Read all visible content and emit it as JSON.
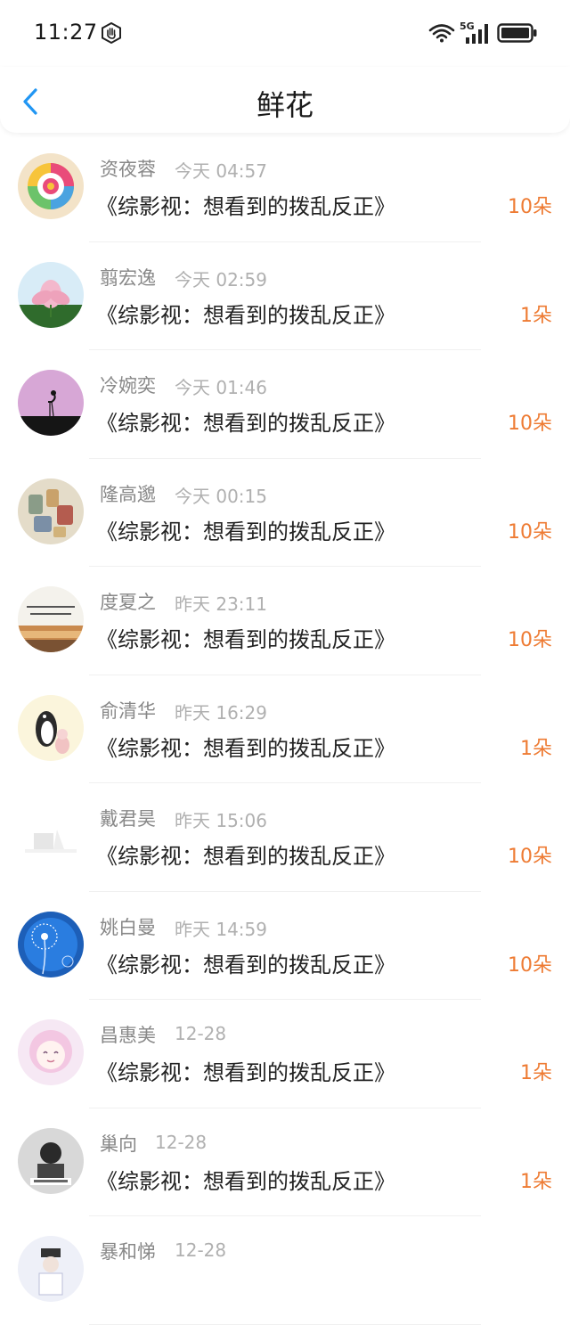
{
  "status_bar": {
    "time": "11:27",
    "network": "5G"
  },
  "header": {
    "title": "鲜花",
    "back_icon": "chevron-left-icon"
  },
  "colors": {
    "accent": "#2196f3",
    "count": "#ee7b33",
    "name": "#888888",
    "time": "#b0b0b0"
  },
  "items": [
    {
      "name": "资夜蓉",
      "time": "今天 04:57",
      "title": "《综影视：想看到的拨乱反正》",
      "count": "10朵",
      "avatar": "lollipop"
    },
    {
      "name": "翦宏逸",
      "time": "今天 02:59",
      "title": "《综影视：想看到的拨乱反正》",
      "count": "1朵",
      "avatar": "lotus"
    },
    {
      "name": "冷婉奕",
      "time": "今天 01:46",
      "title": "《综影视：想看到的拨乱反正》",
      "count": "10朵",
      "avatar": "flamingo"
    },
    {
      "name": "隆高邈",
      "time": "今天 00:15",
      "title": "《综影视：想看到的拨乱反正》",
      "count": "10朵",
      "avatar": "spools"
    },
    {
      "name": "度夏之",
      "time": "昨天 23:11",
      "title": "《综影视：想看到的拨乱反正》",
      "count": "10朵",
      "avatar": "sunset"
    },
    {
      "name": "俞清华",
      "time": "昨天 16:29",
      "title": "《综影视：想看到的拨乱反正》",
      "count": "1朵",
      "avatar": "penguin"
    },
    {
      "name": "戴君昊",
      "time": "昨天 15:06",
      "title": "《综影视：想看到的拨乱反正》",
      "count": "10朵",
      "avatar": "white"
    },
    {
      "name": "姚白曼",
      "time": "昨天 14:59",
      "title": "《综影视：想看到的拨乱反正》",
      "count": "10朵",
      "avatar": "dandelion"
    },
    {
      "name": "昌惠美",
      "time": "12-28",
      "title": "《综影视：想看到的拨乱反正》",
      "count": "1朵",
      "avatar": "anime"
    },
    {
      "name": "巢向",
      "time": "12-28",
      "title": "《综影视：想看到的拨乱反正》",
      "count": "1朵",
      "avatar": "bw"
    },
    {
      "name": "暴和悌",
      "time": "12-28",
      "title": "",
      "count": "",
      "avatar": "figure"
    }
  ]
}
